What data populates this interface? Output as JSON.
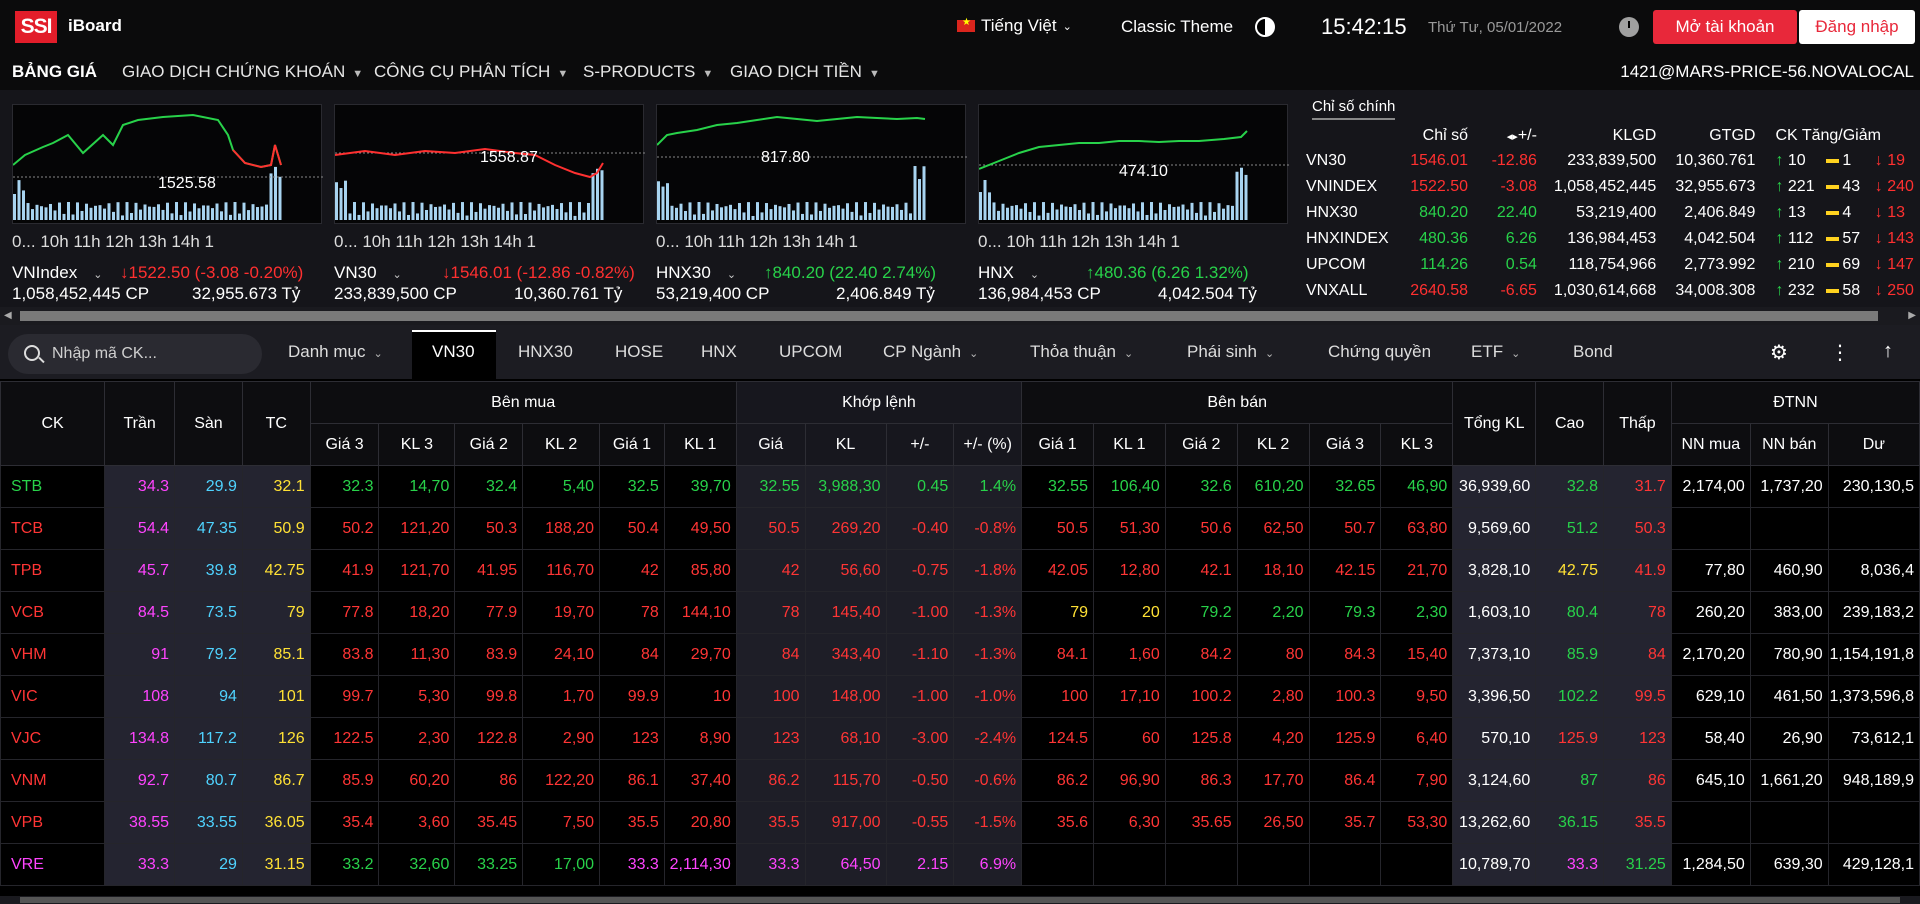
{
  "header": {
    "logo": "SSI",
    "app_name": "iBoard",
    "language": "Tiếng Việt",
    "theme": "Classic Theme",
    "time": "15:42:15",
    "date": "Thứ Tư, 05/01/2022",
    "open_account": "Mở tài khoản",
    "login": "Đăng nhập"
  },
  "menu": {
    "items": [
      {
        "label": "BẢNG GIÁ"
      },
      {
        "label": "GIAO DỊCH CHỨNG KHOÁN"
      },
      {
        "label": "CÔNG CỤ PHÂN TÍCH"
      },
      {
        "label": "S-PRODUCTS"
      },
      {
        "label": "GIAO DỊCH TIỀN"
      }
    ],
    "server": "1421@MARS-PRICE-56.NOVALOCAL"
  },
  "mini_charts": [
    {
      "name": "VNIndex",
      "level": "1525.58",
      "value": "1522.50 (-3.08 -0.20%)",
      "direction": "down",
      "volume": "1,058,452,445 CP",
      "value_ty": "32,955.673 Tỷ",
      "axis": "0...  10h    11h    12h    13h    14h    1"
    },
    {
      "name": "VN30",
      "level": "1558.87",
      "value": "1546.01 (-12.86 -0.82%)",
      "direction": "down",
      "volume": "233,839,500 CP",
      "value_ty": "10,360.761 Tỷ",
      "axis": "0...  10h    11h    12h    13h    14h    1"
    },
    {
      "name": "HNX30",
      "level": "817.80",
      "value": "840.20 (22.40 2.74%)",
      "direction": "up",
      "volume": "53,219,400 CP",
      "value_ty": "2,406.849 Tỷ",
      "axis": "0...  10h    11h    12h    13h    14h    1"
    },
    {
      "name": "HNX",
      "level": "474.10",
      "value": "480.36 (6.26 1.32%)",
      "direction": "up",
      "volume": "136,984,453 CP",
      "value_ty": "4,042.504 Tỷ",
      "axis": "0...  10h    11h    12h    13h    14h    1"
    }
  ],
  "index_panel": {
    "tab": "Chỉ số chính",
    "headers": [
      "",
      "Chỉ số",
      "+/-",
      "KLGD",
      "GTGD",
      "CK Tăng/Giảm"
    ],
    "rows": [
      {
        "name": "VN30",
        "index": "1546.01",
        "change": "-12.86",
        "vol": "233,839,500",
        "val": "10,360.761",
        "up": "10",
        "eq": "1",
        "down": "19",
        "dir": "dn"
      },
      {
        "name": "VNINDEX",
        "index": "1522.50",
        "change": "-3.08",
        "vol": "1,058,452,445",
        "val": "32,955.673",
        "up": "221",
        "eq": "43",
        "down": "240",
        "dir": "dn"
      },
      {
        "name": "HNX30",
        "index": "840.20",
        "change": "22.40",
        "vol": "53,219,400",
        "val": "2,406.849",
        "up": "13",
        "eq": "4",
        "down": "13",
        "dir": "up"
      },
      {
        "name": "HNXINDEX",
        "index": "480.36",
        "change": "6.26",
        "vol": "136,984,453",
        "val": "4,042.504",
        "up": "112",
        "eq": "57",
        "down": "143",
        "dir": "up"
      },
      {
        "name": "UPCOM",
        "index": "114.26",
        "change": "0.54",
        "vol": "118,754,966",
        "val": "2,773.992",
        "up": "210",
        "eq": "69",
        "down": "147",
        "dir": "up"
      },
      {
        "name": "VNXALL",
        "index": "2640.58",
        "change": "-6.65",
        "vol": "1,030,614,668",
        "val": "34,008.308",
        "up": "232",
        "eq": "58",
        "down": "250",
        "dir": "dn"
      }
    ]
  },
  "toolbar": {
    "search_placeholder": "Nhập mã CK...",
    "tabs": [
      "Danh mục",
      "VN30",
      "HNX30",
      "HOSE",
      "HNX",
      "UPCOM",
      "CP Ngành",
      "Thỏa thuận",
      "Phái sinh",
      "Chứng quyền",
      "ETF",
      "Bond"
    ],
    "active_tab": "VN30"
  },
  "board": {
    "group_headers": {
      "buy": "Bên mua",
      "match": "Khớp lệnh",
      "sell": "Bên bán",
      "foreign": "ĐTNN"
    },
    "col_headers": {
      "ck": "CK",
      "ceil": "Trần",
      "floor": "Sàn",
      "ref": "TC",
      "buy": [
        "Giá 3",
        "KL 3",
        "Giá 2",
        "KL 2",
        "Giá 1",
        "KL 1"
      ],
      "match": [
        "Giá",
        "KL",
        "+/-",
        "+/- (%)"
      ],
      "sell": [
        "Giá 1",
        "KL 1",
        "Giá 2",
        "KL 2",
        "Giá 3",
        "KL 3"
      ],
      "total": "Tổng KL",
      "high": "Cao",
      "low": "Thấp",
      "foreign": [
        "NN mua",
        "NN bán",
        "Dư"
      ]
    },
    "rows": [
      {
        "sym": "STB",
        "c": "up",
        "ceil": "34.3",
        "floor": "29.9",
        "ref": "32.1",
        "buy": [
          [
            "32.3",
            "up"
          ],
          [
            "14,70",
            "up"
          ],
          [
            "32.4",
            "up"
          ],
          [
            "5,40",
            "up"
          ],
          [
            "32.5",
            "up"
          ],
          [
            "39,70",
            "up"
          ]
        ],
        "match": [
          [
            "32.55",
            "up"
          ],
          [
            "3,988,30",
            "up"
          ],
          [
            "0.45",
            "up"
          ],
          [
            "1.4%",
            "up"
          ]
        ],
        "sell": [
          [
            "32.55",
            "up"
          ],
          [
            "106,40",
            "up"
          ],
          [
            "32.6",
            "up"
          ],
          [
            "610,20",
            "up"
          ],
          [
            "32.65",
            "up"
          ],
          [
            "46,90",
            "up"
          ]
        ],
        "total": "36,939,60",
        "high": [
          "32.8",
          "up"
        ],
        "low": [
          "31.7",
          "dn"
        ],
        "fb": "2,174,00",
        "fs": "1,737,20",
        "room": "230,130,5"
      },
      {
        "sym": "TCB",
        "c": "dn",
        "ceil": "54.4",
        "floor": "47.35",
        "ref": "50.9",
        "buy": [
          [
            "50.2",
            "dn"
          ],
          [
            "121,20",
            "dn"
          ],
          [
            "50.3",
            "dn"
          ],
          [
            "188,20",
            "dn"
          ],
          [
            "50.4",
            "dn"
          ],
          [
            "49,50",
            "dn"
          ]
        ],
        "match": [
          [
            "50.5",
            "dn"
          ],
          [
            "269,20",
            "dn"
          ],
          [
            "-0.40",
            "dn"
          ],
          [
            "-0.8%",
            "dn"
          ]
        ],
        "sell": [
          [
            "50.5",
            "dn"
          ],
          [
            "51,30",
            "dn"
          ],
          [
            "50.6",
            "dn"
          ],
          [
            "62,50",
            "dn"
          ],
          [
            "50.7",
            "dn"
          ],
          [
            "63,80",
            "dn"
          ]
        ],
        "total": "9,569,60",
        "high": [
          "51.2",
          "up"
        ],
        "low": [
          "50.3",
          "dn"
        ],
        "fb": "",
        "fs": "",
        "room": ""
      },
      {
        "sym": "TPB",
        "c": "dn",
        "ceil": "45.7",
        "floor": "39.8",
        "ref": "42.75",
        "buy": [
          [
            "41.9",
            "dn"
          ],
          [
            "121,70",
            "dn"
          ],
          [
            "41.95",
            "dn"
          ],
          [
            "116,70",
            "dn"
          ],
          [
            "42",
            "dn"
          ],
          [
            "85,80",
            "dn"
          ]
        ],
        "match": [
          [
            "42",
            "dn"
          ],
          [
            "56,60",
            "dn"
          ],
          [
            "-0.75",
            "dn"
          ],
          [
            "-1.8%",
            "dn"
          ]
        ],
        "sell": [
          [
            "42.05",
            "dn"
          ],
          [
            "12,80",
            "dn"
          ],
          [
            "42.1",
            "dn"
          ],
          [
            "18,10",
            "dn"
          ],
          [
            "42.15",
            "dn"
          ],
          [
            "21,70",
            "dn"
          ]
        ],
        "total": "3,828,10",
        "high": [
          "42.75",
          "rf"
        ],
        "low": [
          "41.9",
          "dn"
        ],
        "fb": "77,80",
        "fs": "460,90",
        "room": "8,036,4"
      },
      {
        "sym": "VCB",
        "c": "dn",
        "ceil": "84.5",
        "floor": "73.5",
        "ref": "79",
        "buy": [
          [
            "77.8",
            "dn"
          ],
          [
            "18,20",
            "dn"
          ],
          [
            "77.9",
            "dn"
          ],
          [
            "19,70",
            "dn"
          ],
          [
            "78",
            "dn"
          ],
          [
            "144,10",
            "dn"
          ]
        ],
        "match": [
          [
            "78",
            "dn"
          ],
          [
            "145,40",
            "dn"
          ],
          [
            "-1.00",
            "dn"
          ],
          [
            "-1.3%",
            "dn"
          ]
        ],
        "sell": [
          [
            "79",
            "rf"
          ],
          [
            "20",
            "rf"
          ],
          [
            "79.2",
            "up"
          ],
          [
            "2,20",
            "up"
          ],
          [
            "79.3",
            "up"
          ],
          [
            "2,30",
            "up"
          ]
        ],
        "total": "1,603,10",
        "high": [
          "80.4",
          "up"
        ],
        "low": [
          "78",
          "dn"
        ],
        "fb": "260,20",
        "fs": "383,00",
        "room": "239,183,2"
      },
      {
        "sym": "VHM",
        "c": "dn",
        "ceil": "91",
        "floor": "79.2",
        "ref": "85.1",
        "buy": [
          [
            "83.8",
            "dn"
          ],
          [
            "11,30",
            "dn"
          ],
          [
            "83.9",
            "dn"
          ],
          [
            "24,10",
            "dn"
          ],
          [
            "84",
            "dn"
          ],
          [
            "29,70",
            "dn"
          ]
        ],
        "match": [
          [
            "84",
            "dn"
          ],
          [
            "343,40",
            "dn"
          ],
          [
            "-1.10",
            "dn"
          ],
          [
            "-1.3%",
            "dn"
          ]
        ],
        "sell": [
          [
            "84.1",
            "dn"
          ],
          [
            "1,60",
            "dn"
          ],
          [
            "84.2",
            "dn"
          ],
          [
            "80",
            "dn"
          ],
          [
            "84.3",
            "dn"
          ],
          [
            "15,40",
            "dn"
          ]
        ],
        "total": "7,373,10",
        "high": [
          "85.9",
          "up"
        ],
        "low": [
          "84",
          "dn"
        ],
        "fb": "2,170,20",
        "fs": "780,90",
        "room": "1,154,191,8"
      },
      {
        "sym": "VIC",
        "c": "dn",
        "ceil": "108",
        "floor": "94",
        "ref": "101",
        "buy": [
          [
            "99.7",
            "dn"
          ],
          [
            "5,30",
            "dn"
          ],
          [
            "99.8",
            "dn"
          ],
          [
            "1,70",
            "dn"
          ],
          [
            "99.9",
            "dn"
          ],
          [
            "10",
            "dn"
          ]
        ],
        "match": [
          [
            "100",
            "dn"
          ],
          [
            "148,00",
            "dn"
          ],
          [
            "-1.00",
            "dn"
          ],
          [
            "-1.0%",
            "dn"
          ]
        ],
        "sell": [
          [
            "100",
            "dn"
          ],
          [
            "17,10",
            "dn"
          ],
          [
            "100.2",
            "dn"
          ],
          [
            "2,80",
            "dn"
          ],
          [
            "100.3",
            "dn"
          ],
          [
            "9,50",
            "dn"
          ]
        ],
        "total": "3,396,50",
        "high": [
          "102.2",
          "up"
        ],
        "low": [
          "99.5",
          "dn"
        ],
        "fb": "629,10",
        "fs": "461,50",
        "room": "1,373,596,8"
      },
      {
        "sym": "VJC",
        "c": "dn",
        "ceil": "134.8",
        "floor": "117.2",
        "ref": "126",
        "buy": [
          [
            "122.5",
            "dn"
          ],
          [
            "2,30",
            "dn"
          ],
          [
            "122.8",
            "dn"
          ],
          [
            "2,90",
            "dn"
          ],
          [
            "123",
            "dn"
          ],
          [
            "8,90",
            "dn"
          ]
        ],
        "match": [
          [
            "123",
            "dn"
          ],
          [
            "68,10",
            "dn"
          ],
          [
            "-3.00",
            "dn"
          ],
          [
            "-2.4%",
            "dn"
          ]
        ],
        "sell": [
          [
            "124.5",
            "dn"
          ],
          [
            "60",
            "dn"
          ],
          [
            "125.8",
            "dn"
          ],
          [
            "4,20",
            "dn"
          ],
          [
            "125.9",
            "dn"
          ],
          [
            "6,40",
            "dn"
          ]
        ],
        "total": "570,10",
        "high": [
          "125.9",
          "dn"
        ],
        "low": [
          "123",
          "dn"
        ],
        "fb": "58,40",
        "fs": "26,90",
        "room": "73,612,1"
      },
      {
        "sym": "VNM",
        "c": "dn",
        "ceil": "92.7",
        "floor": "80.7",
        "ref": "86.7",
        "buy": [
          [
            "85.9",
            "dn"
          ],
          [
            "60,20",
            "dn"
          ],
          [
            "86",
            "dn"
          ],
          [
            "122,20",
            "dn"
          ],
          [
            "86.1",
            "dn"
          ],
          [
            "37,40",
            "dn"
          ]
        ],
        "match": [
          [
            "86.2",
            "dn"
          ],
          [
            "115,70",
            "dn"
          ],
          [
            "-0.50",
            "dn"
          ],
          [
            "-0.6%",
            "dn"
          ]
        ],
        "sell": [
          [
            "86.2",
            "dn"
          ],
          [
            "96,90",
            "dn"
          ],
          [
            "86.3",
            "dn"
          ],
          [
            "17,70",
            "dn"
          ],
          [
            "86.4",
            "dn"
          ],
          [
            "7,90",
            "dn"
          ]
        ],
        "total": "3,124,60",
        "high": [
          "87",
          "up"
        ],
        "low": [
          "86",
          "dn"
        ],
        "fb": "645,10",
        "fs": "1,661,20",
        "room": "948,189,9"
      },
      {
        "sym": "VPB",
        "c": "dn",
        "ceil": "38.55",
        "floor": "33.55",
        "ref": "36.05",
        "buy": [
          [
            "35.4",
            "dn"
          ],
          [
            "3,60",
            "dn"
          ],
          [
            "35.45",
            "dn"
          ],
          [
            "7,50",
            "dn"
          ],
          [
            "35.5",
            "dn"
          ],
          [
            "20,80",
            "dn"
          ]
        ],
        "match": [
          [
            "35.5",
            "dn"
          ],
          [
            "917,00",
            "dn"
          ],
          [
            "-0.55",
            "dn"
          ],
          [
            "-1.5%",
            "dn"
          ]
        ],
        "sell": [
          [
            "35.6",
            "dn"
          ],
          [
            "6,30",
            "dn"
          ],
          [
            "35.65",
            "dn"
          ],
          [
            "26,50",
            "dn"
          ],
          [
            "35.7",
            "dn"
          ],
          [
            "53,30",
            "dn"
          ]
        ],
        "total": "13,262,60",
        "high": [
          "36.15",
          "up"
        ],
        "low": [
          "35.5",
          "dn"
        ],
        "fb": "",
        "fs": "",
        "room": ""
      },
      {
        "sym": "VRE",
        "c": "ce",
        "ceil": "33.3",
        "floor": "29",
        "ref": "31.15",
        "buy": [
          [
            "33.2",
            "up"
          ],
          [
            "32,60",
            "up"
          ],
          [
            "33.25",
            "up"
          ],
          [
            "17,00",
            "up"
          ],
          [
            "33.3",
            "ce"
          ],
          [
            "2,114,30",
            "ce"
          ]
        ],
        "match": [
          [
            "33.3",
            "ce"
          ],
          [
            "64,50",
            "ce"
          ],
          [
            "2.15",
            "ce"
          ],
          [
            "6.9%",
            "ce"
          ]
        ],
        "sell": [
          [
            "",
            "w"
          ],
          [
            "",
            "w"
          ],
          [
            "",
            "w"
          ],
          [
            "",
            "w"
          ],
          [
            "",
            "w"
          ],
          [
            "",
            "w"
          ]
        ],
        "total": "10,789,70",
        "high": [
          "33.3",
          "ce"
        ],
        "low": [
          "31.25",
          "up"
        ],
        "fb": "1,284,50",
        "fs": "639,30",
        "room": "429,128,1"
      }
    ]
  },
  "colors": {
    "up": "#28d24a",
    "down": "#ff3535",
    "ref": "#ffe135",
    "ceiling": "#ff44ff",
    "floor": "#4fd3ff",
    "accent": "#e8283a"
  }
}
